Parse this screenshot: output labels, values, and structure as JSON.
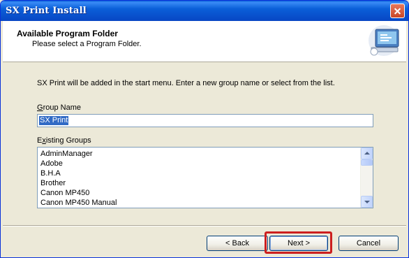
{
  "window": {
    "title": "SX Print Install"
  },
  "header": {
    "title": "Available Program Folder",
    "subtitle": "Please select a Program Folder."
  },
  "main": {
    "intro": "SX Print will be added in the start menu. Enter a new group name  or select from the list.",
    "group_name_label": "Group Name",
    "group_name_value": "SX Print",
    "existing_groups_label": "Existing Groups",
    "existing_groups": [
      "AdminManager",
      "Adobe",
      "B.H.A",
      "Brother",
      "Canon MP450",
      "Canon MP450 Manual"
    ]
  },
  "buttons": {
    "back": "< Back",
    "next": "Next >",
    "cancel": "Cancel"
  },
  "colors": {
    "title_bar": "#0a5fd8",
    "selection": "#316ac5",
    "highlight_border": "#cc1f1f"
  },
  "icons": {
    "header": "computer-icon",
    "close": "close-icon"
  }
}
